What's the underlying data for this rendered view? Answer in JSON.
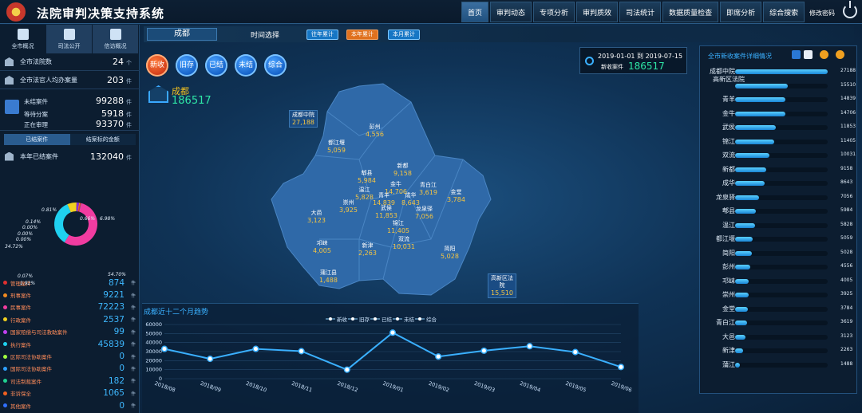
{
  "header": {
    "title": "法院审判决策支持系统",
    "nav": [
      "首页",
      "审判动态",
      "专项分析",
      "审判质效",
      "司法统计",
      "数据质量检查",
      "即席分析",
      "综合搜索"
    ],
    "active_nav": "首页",
    "change_password": "修改密码"
  },
  "left": {
    "tabs": [
      "全市概况",
      "司法公开",
      "信访概况"
    ],
    "rows": [
      {
        "label": "全市法院数",
        "value": "24",
        "unit": "个"
      },
      {
        "label": "全市法官人均办案量",
        "value": "203",
        "unit": "件"
      }
    ],
    "pending": {
      "label": "未结案件",
      "value": "99288",
      "unit": "件",
      "await_label": "等待分案",
      "await_value": "5918",
      "await_unit": "件",
      "trial_label": "正在审理",
      "trial_value": "93370",
      "trial_unit": "件"
    },
    "subtabs": [
      "已结案件",
      "结案标的金额"
    ],
    "closed": {
      "label": "本年已结案件",
      "value": "132040",
      "unit": "件"
    },
    "donut": {
      "slices": [
        {
          "pct": 54.7,
          "label": "54.70%",
          "color": "#f03ca0"
        },
        {
          "pct": 34.72,
          "label": "34.72%",
          "color": "#1fd0f0"
        },
        {
          "pct": 6.98,
          "label": "6.98%",
          "color": "#f0d020"
        },
        {
          "pct": 1.92,
          "label": "1.92%",
          "color": "#8a2cd8"
        },
        {
          "pct": 0.66,
          "label": "0.66%",
          "color": "#ff8c1a"
        },
        {
          "pct": 0.81,
          "label": "0.81%",
          "color": "#f03030"
        },
        {
          "pct": 0.14,
          "label": "0.14%",
          "color": "#2ea0ff"
        },
        {
          "pct": 0.07,
          "label": "0.07%",
          "color": "#a0ff40"
        },
        {
          "pct": 0.0,
          "label": "0.00%",
          "color": "#ffffff"
        },
        {
          "pct": 0.0,
          "label": "0.00%",
          "color": "#ffffff"
        },
        {
          "pct": 0.0,
          "label": "0.00%",
          "color": "#ffffff"
        }
      ]
    },
    "legend": [
      {
        "name": "管理案件",
        "value": "874",
        "unit": "件",
        "color": "#e03030"
      },
      {
        "name": "刑事案件",
        "value": "9221",
        "unit": "件",
        "color": "#f08a20"
      },
      {
        "name": "民事案件",
        "value": "72223",
        "unit": "件",
        "color": "#f03ca0"
      },
      {
        "name": "行政案件",
        "value": "2537",
        "unit": "件",
        "color": "#f0d020"
      },
      {
        "name": "国家赔偿与司法救助案件",
        "value": "99",
        "unit": "件",
        "color": "#c040f0"
      },
      {
        "name": "执行案件",
        "value": "45839",
        "unit": "件",
        "color": "#1fd0f0"
      },
      {
        "name": "区际司法协助案件",
        "value": "0",
        "unit": "件",
        "color": "#a0ff40"
      },
      {
        "name": "国际司法协助案件",
        "value": "0",
        "unit": "件",
        "color": "#2ea0ff"
      },
      {
        "name": "司法制裁案件",
        "value": "182",
        "unit": "件",
        "color": "#20d090"
      },
      {
        "name": "非诉保全",
        "value": "1065",
        "unit": "件",
        "color": "#f06020"
      },
      {
        "name": "其他案件",
        "value": "0",
        "unit": "件",
        "color": "#3070ff"
      }
    ]
  },
  "center": {
    "city": "成都",
    "time_select": "时间选择",
    "time_buttons": [
      {
        "label": "往年累计",
        "active": false
      },
      {
        "label": "本年累计",
        "active": true
      },
      {
        "label": "本月累计",
        "active": false
      }
    ],
    "case_circles": [
      {
        "label": "新收",
        "active": true
      },
      {
        "label": "旧存",
        "active": false
      },
      {
        "label": "已结",
        "active": false
      },
      {
        "label": "未结",
        "active": false
      },
      {
        "label": "综合",
        "active": false
      }
    ],
    "city_label": "成都",
    "city_total": "186517",
    "date_range": "2019-01-01 到 2019-07-15",
    "new_cases_label": "新收案件",
    "new_cases_value": "186517",
    "districts": [
      {
        "name": "成都中院",
        "value": "27,188",
        "boxed": true
      },
      {
        "name": "彭州",
        "value": "4,556"
      },
      {
        "name": "都江堰",
        "value": "5,059"
      },
      {
        "name": "新都",
        "value": "9,158"
      },
      {
        "name": "郫县",
        "value": "5,984"
      },
      {
        "name": "金牛",
        "value": "14,706"
      },
      {
        "name": "温江",
        "value": "5,828"
      },
      {
        "name": "青羊",
        "value": "14,839"
      },
      {
        "name": "成华",
        "value": "8,643"
      },
      {
        "name": "青白江",
        "value": "3,619"
      },
      {
        "name": "金堂",
        "value": "3,784"
      },
      {
        "name": "崇州",
        "value": "3,925"
      },
      {
        "name": "武侯",
        "value": "11,853"
      },
      {
        "name": "龙泉驿",
        "value": "7,056"
      },
      {
        "name": "锦江",
        "value": "11,405"
      },
      {
        "name": "大邑",
        "value": "3,123"
      },
      {
        "name": "双流",
        "value": "10,031"
      },
      {
        "name": "邛崃",
        "value": "4,005"
      },
      {
        "name": "新津",
        "value": "2,263"
      },
      {
        "name": "简阳",
        "value": "5,028"
      },
      {
        "name": "蒲江县",
        "value": "1,488"
      },
      {
        "name": "高新区法院",
        "value": "15,510",
        "boxed": true
      }
    ]
  },
  "trend": {
    "title": "成都近十二个月趋势"
  },
  "chart_data": {
    "type": "line",
    "title": "成都近十二个月趋势",
    "categories": [
      "2018/08",
      "2018/09",
      "2018/10",
      "2018/11",
      "2018/12",
      "2019/01",
      "2019/02",
      "2019/03",
      "2019/04",
      "2019/05",
      "2019/06"
    ],
    "series": [
      {
        "name": "新收",
        "values": [
          33000,
          22000,
          33000,
          30500,
          10000,
          51000,
          24500,
          31000,
          36000,
          29500,
          13000
        ],
        "color": "#3ab0ff"
      },
      {
        "name": "旧存",
        "values": []
      },
      {
        "name": "已结",
        "values": []
      },
      {
        "name": "未结",
        "values": []
      },
      {
        "name": "综合",
        "values": []
      }
    ],
    "ylim": [
      0,
      60000
    ],
    "yticks": [
      0,
      10000,
      20000,
      30000,
      40000,
      50000,
      60000
    ],
    "grid": true,
    "legend": "top-center"
  },
  "right": {
    "title": "全市新收案件详细情况",
    "items": [
      {
        "name": "成都中院",
        "value": 27188
      },
      {
        "name": "高新区法院",
        "value": 15510
      },
      {
        "name": "青羊",
        "value": 14839
      },
      {
        "name": "金牛",
        "value": 14706
      },
      {
        "name": "武侯",
        "value": 11853
      },
      {
        "name": "锦江",
        "value": 11405
      },
      {
        "name": "双流",
        "value": 10031
      },
      {
        "name": "新都",
        "value": 9158
      },
      {
        "name": "成华",
        "value": 8643
      },
      {
        "name": "龙泉驿",
        "value": 7056
      },
      {
        "name": "郫县",
        "value": 5984
      },
      {
        "name": "温江",
        "value": 5828
      },
      {
        "name": "都江堰",
        "value": 5059
      },
      {
        "name": "简阳",
        "value": 5028
      },
      {
        "name": "彭州",
        "value": 4556
      },
      {
        "name": "邛崃",
        "value": 4005
      },
      {
        "name": "崇州",
        "value": 3925
      },
      {
        "name": "金堂",
        "value": 3784
      },
      {
        "name": "青白江",
        "value": 3619
      },
      {
        "name": "大邑",
        "value": 3123
      },
      {
        "name": "新津",
        "value": 2263
      },
      {
        "name": "蒲江",
        "value": 1488
      }
    ]
  },
  "colors": {
    "accent": "#3ab0ff",
    "highlight": "#f5c542",
    "green": "#2ee6a6",
    "active_orange": "#e0711e"
  }
}
